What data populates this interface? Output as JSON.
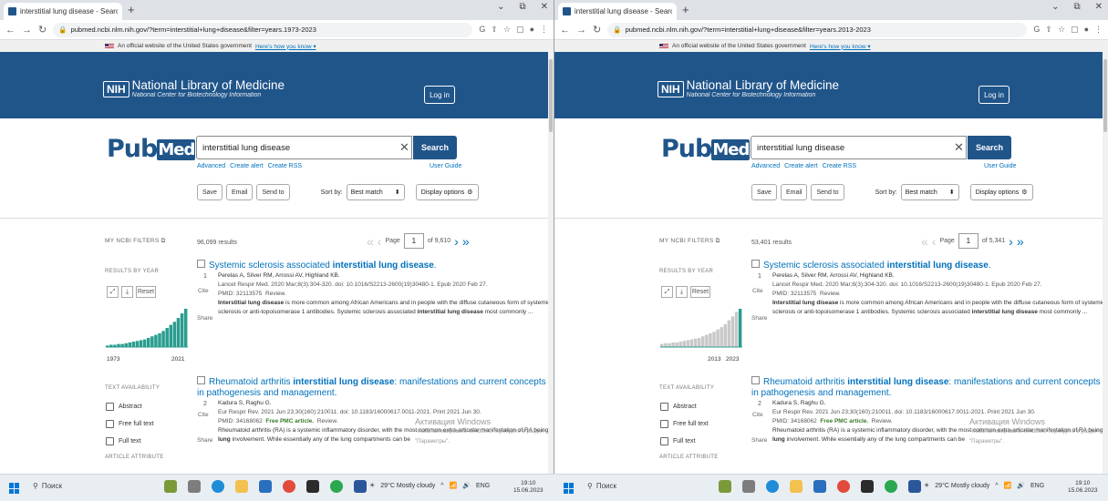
{
  "panes": [
    {
      "id": "left",
      "tab_title": "interstitial lung disease - Search ×",
      "url": "pubmed.ncbi.nlm.nih.gov/?term=interstitial+lung+disease&filter=years.1973-2023",
      "results_count": "96,099 results",
      "page": "1",
      "page_of": "of 9,610",
      "year_start": "1973",
      "year_end": "2021"
    },
    {
      "id": "right",
      "tab_title": "interstitial lung disease - Search ×",
      "url": "pubmed.ncbi.nlm.nih.gov/?term=interstitial+lung+disease&filter=years.2013-2023",
      "results_count": "53,401 results",
      "page": "1",
      "page_of": "of 5,341",
      "year_start": "2013",
      "year_end": "2023"
    }
  ],
  "gov_banner": {
    "text": "An official website of the United States government",
    "link": "Here's how you know ▾"
  },
  "header": {
    "nih": "NIH",
    "title": "National Library of Medicine",
    "subtitle": "National Center for Biotechnology Information",
    "login": "Log in"
  },
  "search": {
    "logo_pub": "Pub",
    "logo_med": "Med",
    "logo_reg": "®",
    "query": "interstitial lung disease",
    "button": "Search",
    "advanced": "Advanced",
    "create_alert": "Create alert",
    "create_rss": "Create RSS",
    "user_guide": "User Guide"
  },
  "actions": {
    "save": "Save",
    "email": "Email",
    "send_to": "Send to",
    "sort_by": "Sort by:",
    "sort_value": "Best match",
    "display": "Display options"
  },
  "pager": {
    "page_label": "Page"
  },
  "sidebar": {
    "my_filters": "MY NCBI FILTERS",
    "results_by_year": "RESULTS BY YEAR",
    "reset": "Reset",
    "text_availability": "TEXT AVAILABILITY",
    "abstract": "Abstract",
    "free_full_text": "Free full text",
    "full_text": "Full text",
    "article_attribute": "ARTICLE ATTRIBUTE"
  },
  "histogram": {
    "left": [
      2,
      3,
      3,
      4,
      4,
      5,
      6,
      7,
      8,
      9,
      10,
      12,
      14,
      16,
      18,
      21,
      25,
      29,
      33,
      38,
      44,
      50
    ],
    "right": [
      4,
      5,
      5,
      6,
      6,
      7,
      8,
      9,
      10,
      11,
      12,
      14,
      16,
      18,
      20,
      23,
      26,
      30,
      35,
      40,
      46,
      50
    ]
  },
  "colors": {
    "header": "#20558a",
    "link": "#0071bc",
    "hist_left": "#2a9d8f",
    "hist_right": "#c9c9c9"
  },
  "articles": [
    {
      "num": "1",
      "title_pre": "Systemic sclerosis associated ",
      "title_bold": "interstitial lung disease",
      "title_post": ".",
      "authors": "Perelas A, Silver RM, Arrossi AV, Highland KB.",
      "citation": "Lancet Respir Med. 2020 Mar;8(3):304-320. doi: 10.1016/S2213-2600(19)30480-1. Epub 2020 Feb 27.",
      "pmid": "PMID: 32113575",
      "type": "Review.",
      "free_pmc": "",
      "snippet_bold": "Interstitial lung disease",
      "snippet": " is more common among African Americans and in people with the diffuse cutaneous form of systemic sclerosis or anti-topoisomerase 1 antibodies. Systemic sclerosis associated ",
      "snippet_bold2": "interstitial lung disease",
      "snippet_end": " most commonly ..."
    },
    {
      "num": "2",
      "title_pre": "Rheumatoid arthritis ",
      "title_bold": "interstitial lung disease",
      "title_post": ": manifestations and current concepts in pathogenesis and management.",
      "authors": "Kadura S, Raghu G.",
      "citation": "Eur Respir Rev. 2021 Jun 23;30(160):210011. doi: 10.1183/16000617.0011-2021. Print 2021 Jun 30.",
      "pmid": "PMID: 34168062",
      "type": "Review.",
      "free_pmc": "Free PMC article.",
      "snippet_bold": "",
      "snippet": "Rheumatoid arthritis (RA) is a systemic inflammatory disorder, with the most common extra-articular manifestation of RA being ",
      "snippet_bold2": "lung",
      "snippet_end": " involvement. While essentially any of the lung compartments can be"
    }
  ],
  "labels": {
    "cite": "Cite",
    "share": "Share"
  },
  "watermark": {
    "title": "Активация Windows",
    "sub": "Чтобы активировать Windows, перейдите в раздел \"Параметры\"."
  },
  "taskbar": {
    "search": "Поиск",
    "weather": "29°C Mostly cloudy",
    "lang": "ENG",
    "time": "19:10",
    "date": "15.06.2023"
  }
}
